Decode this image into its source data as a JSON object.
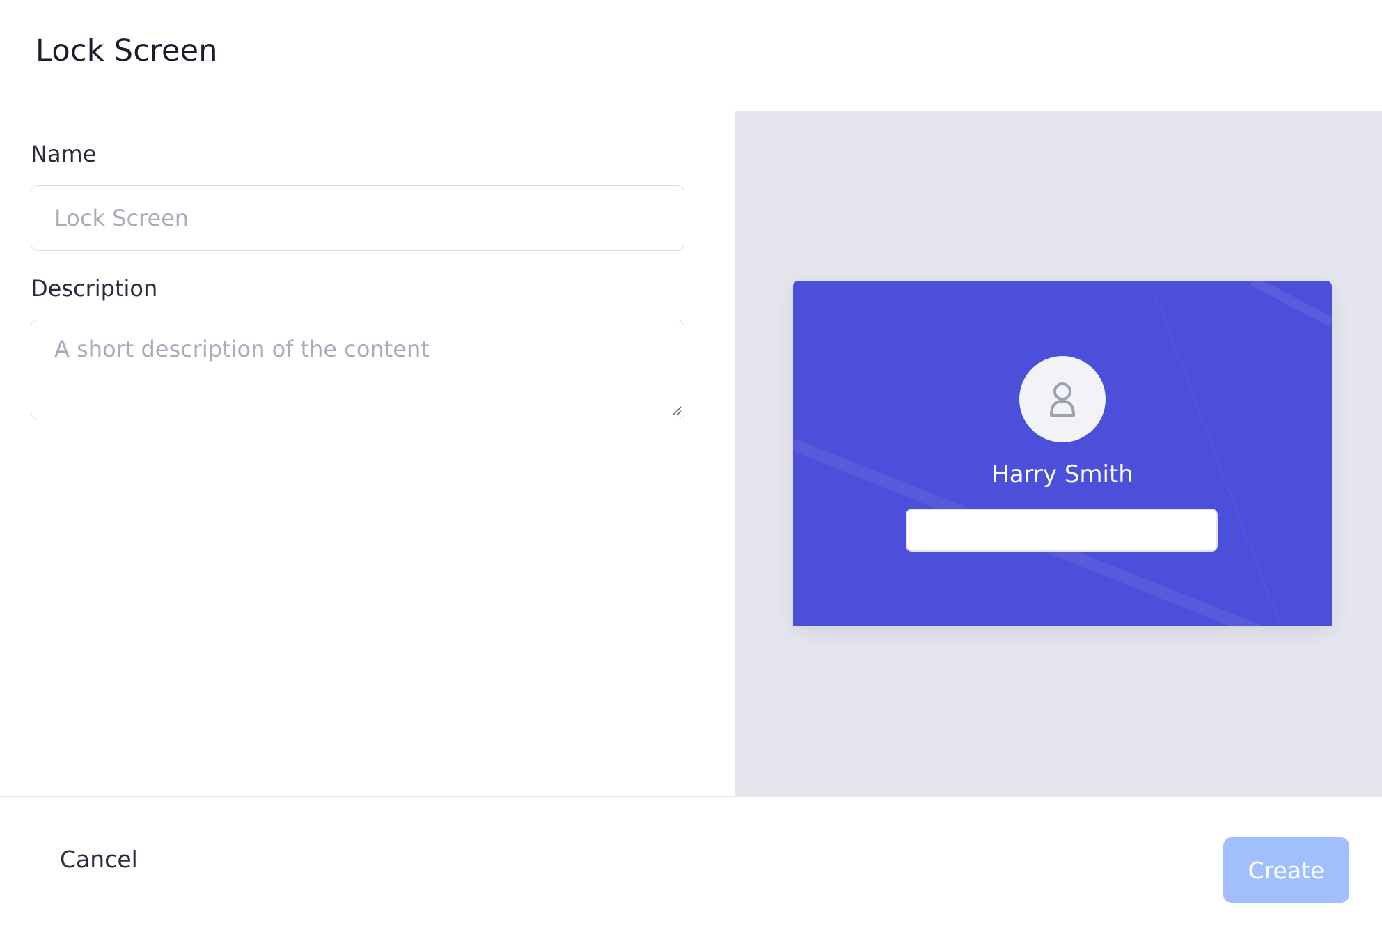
{
  "header": {
    "title": "Lock Screen"
  },
  "form": {
    "name_label": "Name",
    "name_placeholder": "Lock Screen",
    "description_label": "Description",
    "description_placeholder": "A short description of the content"
  },
  "preview": {
    "user_name": "Harry Smith",
    "card_color": "#4B4FD9",
    "avatar_icon": "user-icon"
  },
  "footer": {
    "cancel_label": "Cancel",
    "create_label": "Create",
    "create_color": "#A1BEFD"
  }
}
